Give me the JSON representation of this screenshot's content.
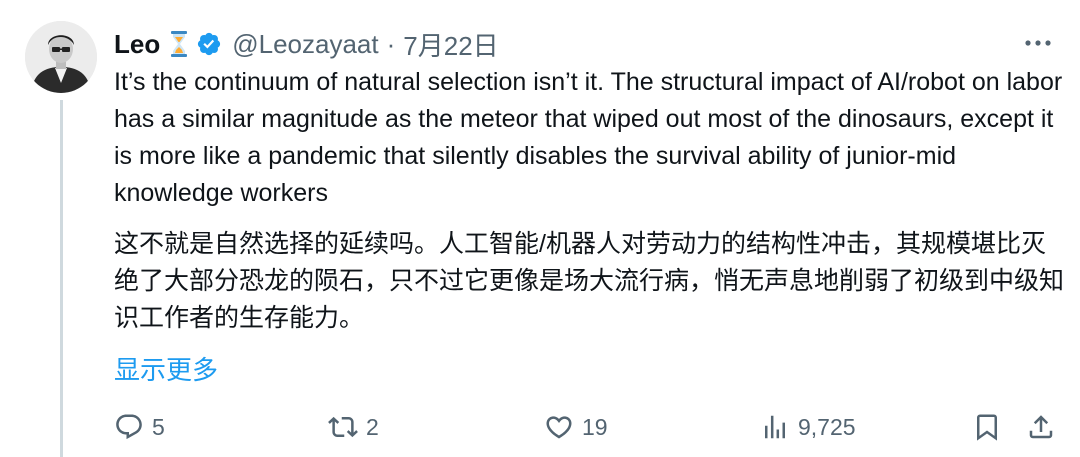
{
  "tweet": {
    "author": {
      "display_name": "Leo",
      "emoji": "⌛",
      "handle": "@Leozayaat",
      "verified": true
    },
    "separator": "·",
    "date": "7月22日",
    "text_en": "It’s the continuum of natural selection isn’t it. The structural impact of AI/robot on labor has a similar magnitude as the meteor that wiped out most of the dinosaurs, except it is more like a pandemic that silently disables the survival ability of junior-mid knowledge workers",
    "text_zh": "这不就是自然选择的延续吗。人工智能/机器人对劳动力的结构性冲击，其规模堪比灭绝了大部分恐龙的陨石，只不过它更像是场大流行病，悄无声息地削弱了初级到中级知识工作者的生存能力。",
    "show_more_label": "显示更多",
    "stats": {
      "replies": "5",
      "retweets": "2",
      "likes": "19",
      "views": "9,725"
    }
  },
  "colors": {
    "accent": "#1d9bf0",
    "text": "#0f1419",
    "muted": "#536471",
    "thread_line": "#cfd9de"
  },
  "icons": {
    "more": "ellipsis-icon",
    "reply": "reply-icon",
    "retweet": "retweet-icon",
    "like": "heart-icon",
    "views": "views-bar-chart-icon",
    "bookmark": "bookmark-icon",
    "share": "share-icon"
  }
}
